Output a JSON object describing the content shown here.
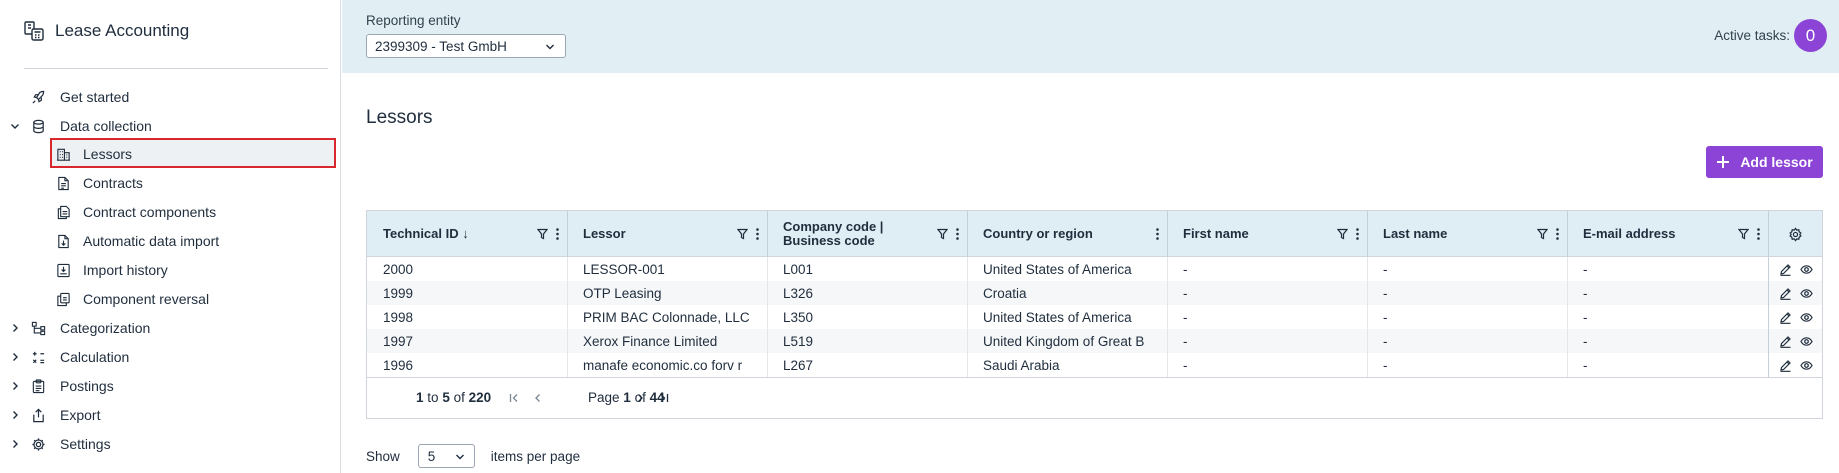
{
  "app": {
    "title": "Lease Accounting",
    "icon": "building-calc-icon"
  },
  "sidebar": {
    "items": [
      {
        "label": "Get started",
        "icon": "rocket-icon"
      },
      {
        "label": "Data collection",
        "icon": "database-icon",
        "expanded": true
      },
      {
        "label": "Lessors",
        "icon": "building-icon",
        "selected": true
      },
      {
        "label": "Contracts",
        "icon": "document-icon"
      },
      {
        "label": "Contract components",
        "icon": "documents-icon"
      },
      {
        "label": "Automatic data import",
        "icon": "file-import-icon"
      },
      {
        "label": "Import history",
        "icon": "import-tray-icon"
      },
      {
        "label": "Component reversal",
        "icon": "reversal-icon"
      },
      {
        "label": "Categorization",
        "icon": "hierarchy-icon"
      },
      {
        "label": "Calculation",
        "icon": "calculator-icon"
      },
      {
        "label": "Postings",
        "icon": "clipboard-icon"
      },
      {
        "label": "Export",
        "icon": "export-icon"
      },
      {
        "label": "Settings",
        "icon": "gear-icon"
      }
    ]
  },
  "topbar": {
    "entity_label": "Reporting entity",
    "entity_value": "2399309 - Test GmbH",
    "active_tasks_label": "Active tasks:",
    "active_tasks_count": "0"
  },
  "main": {
    "title": "Lessors",
    "add_button": "Add lessor"
  },
  "table": {
    "columns": [
      {
        "label": "Technical ID ↓",
        "filter": true
      },
      {
        "label": "Lessor",
        "filter": true
      },
      {
        "label": "Company code | Business code",
        "filter": true
      },
      {
        "label": "Country or region",
        "filter": false
      },
      {
        "label": "First name",
        "filter": true
      },
      {
        "label": "Last name",
        "filter": true
      },
      {
        "label": "E-mail address",
        "filter": true
      }
    ],
    "rows": [
      [
        "2000",
        "LESSOR-001",
        "L001",
        "United States of America",
        "-",
        "-",
        "-"
      ],
      [
        "1999",
        "OTP Leasing",
        "L326",
        "Croatia",
        "-",
        "-",
        "-"
      ],
      [
        "1998",
        "PRIM BAC Colonnade, LLC",
        "L350",
        "United States of America",
        "-",
        "-",
        "-"
      ],
      [
        "1997",
        "Xerox Finance Limited",
        "L519",
        "United Kingdom of Great B",
        "-",
        "-",
        "-"
      ],
      [
        "1996",
        "manafe economic.co forv r",
        "L267",
        "Saudi Arabia",
        "-",
        "-",
        "-"
      ]
    ]
  },
  "pager": {
    "from": "1",
    "to_word": "to",
    "to": "5",
    "of_word": "of",
    "total": "220",
    "page_word": "Page",
    "page": "1",
    "pages": "44"
  },
  "per_page": {
    "show_label": "Show",
    "value": "5",
    "suffix": "items per page"
  },
  "colors": {
    "accent": "#8c44d6",
    "header_bg": "#dfeef4",
    "topbar_bg": "#e1eff4",
    "selection_border": "#d9272e"
  }
}
